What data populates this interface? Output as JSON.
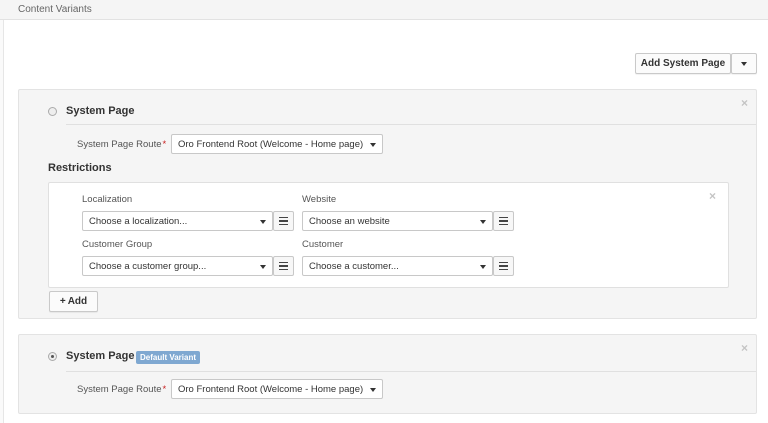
{
  "header": {
    "title": "Content Variants"
  },
  "toolbar": {
    "add_label": "Add System Page"
  },
  "variants": [
    {
      "title": "System Page",
      "route_label": "System Page Route",
      "route_value": "Oro Frontend Root (Welcome - Home page)",
      "selected": false,
      "restrictions": {
        "title": "Restrictions",
        "localization_label": "Localization",
        "localization_value": "Choose a localization...",
        "website_label": "Website",
        "website_value": "Choose an website",
        "customer_group_label": "Customer Group",
        "customer_group_value": "Choose a customer group...",
        "customer_label": "Customer",
        "customer_value": "Choose a customer...",
        "add_label": "Add"
      }
    },
    {
      "title": "System Page",
      "badge": "Default Variant",
      "route_label": "System Page Route",
      "route_value": "Oro Frontend Root (Welcome - Home page)",
      "selected": true
    }
  ],
  "colors": {
    "badge": "#7fa8d1",
    "required": "#c81e1e"
  },
  "icons": {
    "close": "close-icon",
    "list": "list-icon",
    "caret": "chevron-down-icon"
  }
}
